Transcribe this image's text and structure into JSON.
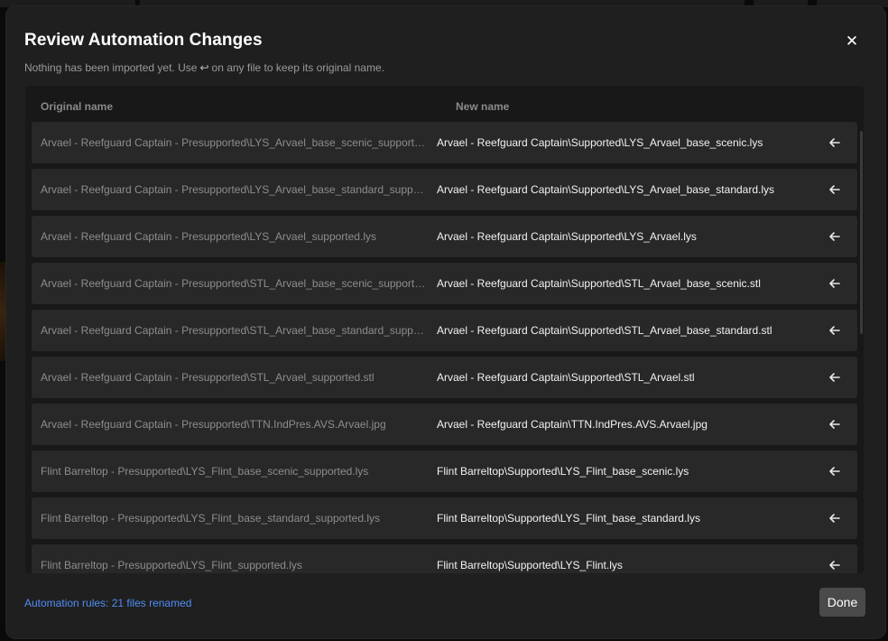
{
  "dialog": {
    "title": "Review Automation Changes",
    "close_glyph": "✕",
    "subtitle_pre": "Nothing has been imported yet. Use",
    "subtitle_glyph": "↩",
    "subtitle_post": "on any file to keep its original name."
  },
  "table": {
    "header_original": "Original name",
    "header_new": "New name",
    "revert_icon": "arrow-left-icon",
    "rows": [
      {
        "original": "Arvael - Reefguard Captain - Presupported\\LYS_Arvael_base_scenic_supported.lys",
        "new": "Arvael - Reefguard Captain\\Supported\\LYS_Arvael_base_scenic.lys"
      },
      {
        "original": "Arvael - Reefguard Captain - Presupported\\LYS_Arvael_base_standard_supported.lys",
        "new": "Arvael - Reefguard Captain\\Supported\\LYS_Arvael_base_standard.lys"
      },
      {
        "original": "Arvael - Reefguard Captain - Presupported\\LYS_Arvael_supported.lys",
        "new": "Arvael - Reefguard Captain\\Supported\\LYS_Arvael.lys"
      },
      {
        "original": "Arvael - Reefguard Captain - Presupported\\STL_Arvael_base_scenic_supported.stl",
        "new": "Arvael - Reefguard Captain\\Supported\\STL_Arvael_base_scenic.stl"
      },
      {
        "original": "Arvael - Reefguard Captain - Presupported\\STL_Arvael_base_standard_supported.stl",
        "new": "Arvael - Reefguard Captain\\Supported\\STL_Arvael_base_standard.stl"
      },
      {
        "original": "Arvael - Reefguard Captain - Presupported\\STL_Arvael_supported.stl",
        "new": "Arvael - Reefguard Captain\\Supported\\STL_Arvael.stl"
      },
      {
        "original": "Arvael - Reefguard Captain - Presupported\\TTN.IndPres.AVS.Arvael.jpg",
        "new": "Arvael - Reefguard Captain\\TTN.IndPres.AVS.Arvael.jpg"
      },
      {
        "original": "Flint Barreltop - Presupported\\LYS_Flint_base_scenic_supported.lys",
        "new": "Flint Barreltop\\Supported\\LYS_Flint_base_scenic.lys"
      },
      {
        "original": "Flint Barreltop - Presupported\\LYS_Flint_base_standard_supported.lys",
        "new": "Flint Barreltop\\Supported\\LYS_Flint_base_standard.lys"
      },
      {
        "original": "Flint Barreltop - Presupported\\LYS_Flint_supported.lys",
        "new": "Flint Barreltop\\Supported\\LYS_Flint.lys"
      }
    ]
  },
  "footer": {
    "status": "Automation rules: 21 files renamed",
    "done_label": "Done"
  },
  "colors": {
    "accent_link": "#4f8df5",
    "dialog_bg": "#1f1f1f",
    "row_bg": "#282828"
  }
}
